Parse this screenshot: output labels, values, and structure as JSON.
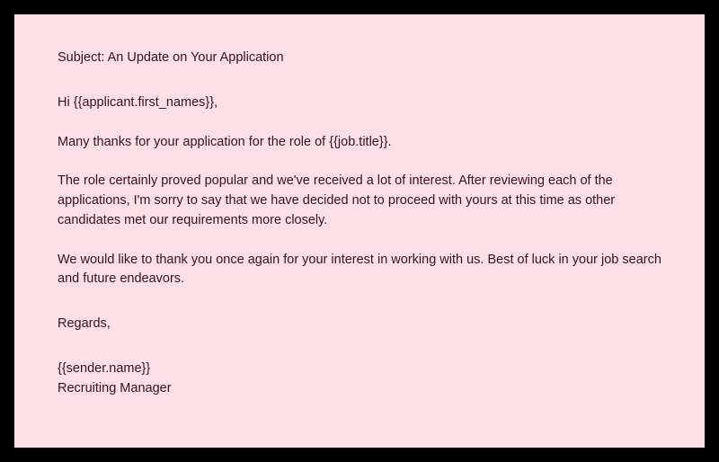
{
  "email": {
    "subject_line": "Subject: An Update on Your Application",
    "greeting": "Hi {{applicant.first_names}},",
    "paragraphs": {
      "p1": "Many thanks for your application for the role of {{job.title}}.",
      "p2": "The role certainly proved popular and we've received a lot of interest. After reviewing each of the applications, I'm sorry to say that we have decided not to proceed with yours at this time as other candidates met our requirements more closely.",
      "p3": "We would like to thank you once again for your interest in working with us. Best of luck in your job search and future endeavors."
    },
    "regards": "Regards,",
    "signature": {
      "name": "{{sender.name}}",
      "title": "Recruiting Manager"
    }
  }
}
